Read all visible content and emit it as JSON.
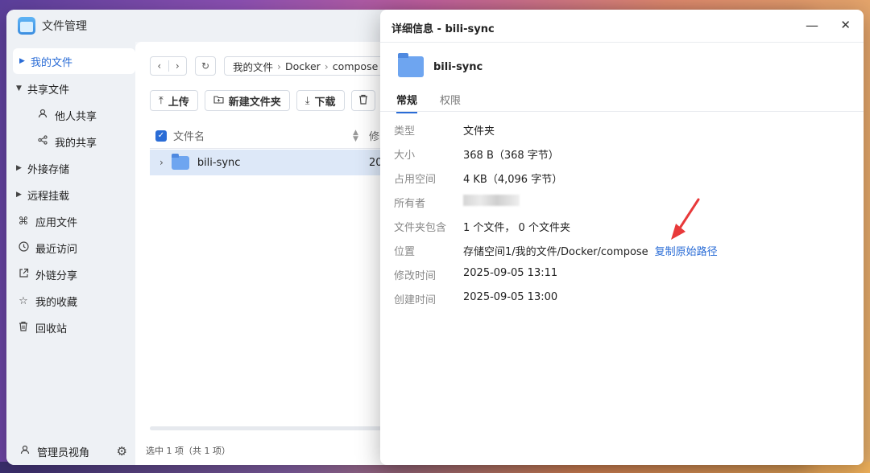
{
  "app": {
    "title": "文件管理"
  },
  "sidebar": {
    "items": [
      {
        "label": "我的文件",
        "active": true,
        "expand": "right"
      },
      {
        "label": "共享文件",
        "expand": "down"
      },
      {
        "label": "他人共享",
        "sub": true,
        "icon": "person-icon"
      },
      {
        "label": "我的共享",
        "sub": true,
        "icon": "share-icon"
      },
      {
        "label": "外接存储",
        "expand": "right"
      },
      {
        "label": "远程挂载",
        "expand": "right"
      },
      {
        "label": "应用文件",
        "icon": "apps-icon"
      },
      {
        "label": "最近访问",
        "icon": "clock-icon"
      },
      {
        "label": "外链分享",
        "icon": "external-link-icon"
      },
      {
        "label": "我的收藏",
        "icon": "star-icon"
      },
      {
        "label": "回收站",
        "icon": "trash-icon"
      }
    ],
    "footer_label": "管理员视角"
  },
  "main": {
    "path": [
      "我的文件",
      "Docker",
      "compose"
    ],
    "toolbar": {
      "upload": "上传",
      "new_folder": "新建文件夹",
      "download": "下载"
    },
    "columns": {
      "name": "文件名",
      "modified": "修"
    },
    "row": {
      "name": "bili-sync",
      "date": "20"
    },
    "status": "选中 1 项（共 1 项）"
  },
  "dialog": {
    "title": "详细信息 - bili-sync",
    "name": "bili-sync",
    "tabs": [
      "常规",
      "权限"
    ],
    "props": [
      {
        "label": "类型",
        "value": "文件夹"
      },
      {
        "label": "大小",
        "value": "368 B（368 字节）"
      },
      {
        "label": "占用空间",
        "value": "4 KB（4,096 字节）"
      },
      {
        "label": "所有者",
        "value": ""
      },
      {
        "label": "文件夹包含",
        "value": "1 个文件， 0 个文件夹"
      },
      {
        "label": "位置",
        "value": "存储空间1/我的文件/Docker/compose"
      },
      {
        "label": "修改时间",
        "value": "2025-09-05 13:11"
      },
      {
        "label": "创建时间",
        "value": "2025-09-05 13:00"
      }
    ],
    "copy_link": "复制原始路径"
  },
  "colors": {
    "accent": "#2a6cd6",
    "annotation_arrow": "#e8393a"
  }
}
